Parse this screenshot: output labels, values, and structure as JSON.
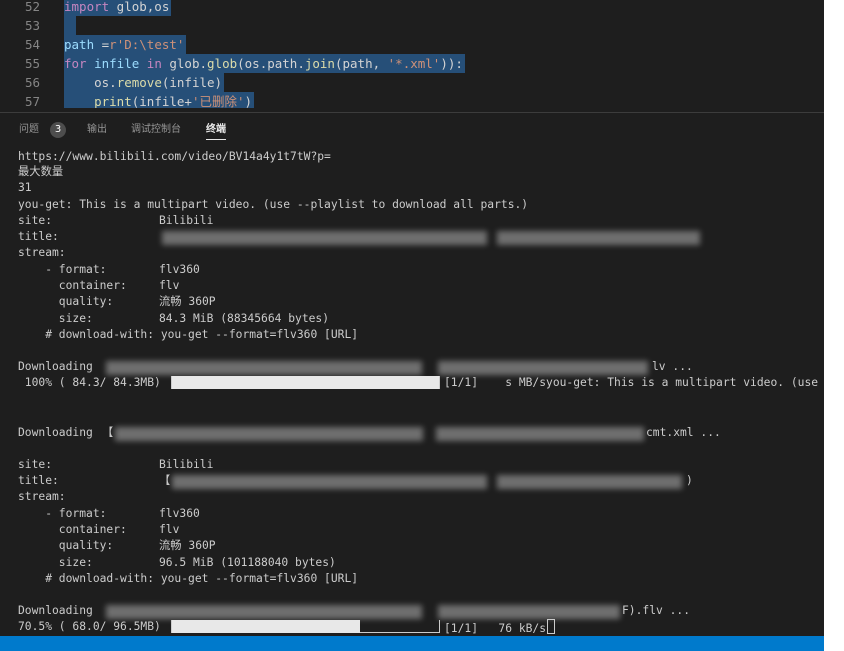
{
  "editor": {
    "lines": [
      {
        "num": "52",
        "tokens": [
          {
            "t": "import",
            "c": "kw"
          },
          {
            "t": " glob,os",
            "c": "op"
          }
        ]
      },
      {
        "num": "53",
        "tokens": []
      },
      {
        "num": "54",
        "tokens": [
          {
            "t": "path",
            "c": "var"
          },
          {
            "t": " =",
            "c": "op"
          },
          {
            "t": "r'D:\\test'",
            "c": "str"
          }
        ]
      },
      {
        "num": "55",
        "tokens": [
          {
            "t": "for",
            "c": "kw"
          },
          {
            "t": " infile ",
            "c": "var"
          },
          {
            "t": "in",
            "c": "kw"
          },
          {
            "t": " glob.",
            "c": "op"
          },
          {
            "t": "glob",
            "c": "fn"
          },
          {
            "t": "(os.path.",
            "c": "op"
          },
          {
            "t": "join",
            "c": "fn"
          },
          {
            "t": "(path, ",
            "c": "op"
          },
          {
            "t": "'*.xml'",
            "c": "str"
          },
          {
            "t": ")):",
            "c": "op"
          }
        ]
      },
      {
        "num": "56",
        "tokens": [
          {
            "t": "    os.",
            "c": "op"
          },
          {
            "t": "remove",
            "c": "fn"
          },
          {
            "t": "(infile)",
            "c": "op"
          }
        ]
      },
      {
        "num": "57",
        "tokens": [
          {
            "t": "    ",
            "c": "op"
          },
          {
            "t": "print",
            "c": "fn"
          },
          {
            "t": "(infile+",
            "c": "op"
          },
          {
            "t": "'已删除'",
            "c": "str"
          },
          {
            "t": ")",
            "c": "op"
          }
        ]
      }
    ]
  },
  "panel": {
    "tabs": {
      "problems": "问题",
      "problems_count": "3",
      "output": "输出",
      "debug_console": "调试控制台",
      "terminal": "终端"
    }
  },
  "terminal": {
    "url": "https://www.bilibili.com/video/BV14a4y1t7tW?p=",
    "prompt_max": "最大数量",
    "max_value": "31",
    "multipart_note": "you-get: This is a multipart video. (use --playlist to download all parts.)",
    "video1": {
      "site_label": "site:",
      "site_value": "Bilibili",
      "title_label": "title:",
      "stream_label": "stream:",
      "format_label": "    - format:",
      "format_value": "flv360",
      "container_label": "      container:",
      "container_value": "flv",
      "quality_label": "      quality:",
      "quality_value": "流畅 360P",
      "size_label": "      size:",
      "size_value": "84.3 MiB (88345664 bytes)",
      "download_with": "    # download-with: you-get --format=flv360 [URL]",
      "downloading_label": "Downloading",
      "downloading_tail": "lv ...",
      "progress_text": " 100% ( 84.3/ 84.3MB)",
      "progress_fraction": 1.0,
      "progress_tail": "[1/1]    s MB/syou-get: This is a multipart video. (use -"
    },
    "danmaku": {
      "downloading_label": "Downloading",
      "bracket": "【",
      "tail": "cmt.xml ..."
    },
    "video2": {
      "site_label": "site:",
      "site_value": "Bilibili",
      "title_label": "title:",
      "title_bracket": "【",
      "title_tail": ")",
      "stream_label": "stream:",
      "format_label": "    - format:",
      "format_value": "flv360",
      "container_label": "      container:",
      "container_value": "flv",
      "quality_label": "      quality:",
      "quality_value": "流畅 360P",
      "size_label": "      size:",
      "size_value": "96.5 MiB (101188040 bytes)",
      "download_with": "    # download-with: you-get --format=flv360 [URL]",
      "downloading_label": "Downloading",
      "downloading_tail": "F).flv ...",
      "progress_text": "70.5% ( 68.0/ 96.5MB)",
      "progress_fraction": 0.705,
      "progress_tail": "[1/1]   76 kB/s"
    }
  },
  "colors": {
    "editor_bg": "#1e1e1e",
    "selection": "#264f78",
    "keyword": "#c586c0",
    "function": "#dcdcaa",
    "variable": "#9cdcfe",
    "string": "#ce9178",
    "terminal_text": "#cccccc",
    "statusbar": "#007acc"
  }
}
